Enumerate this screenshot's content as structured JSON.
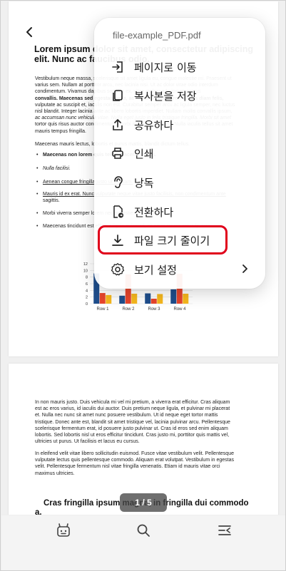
{
  "document": {
    "title_lines": [
      "Lorem ipsum dolor sit amet, consectetur adipiscing",
      "elit. Nunc ac faucibus odio."
    ],
    "paragraph1": [
      "Vestibulum neque massa, scelerisque sit amet ligula eu, congue molestie mi. Praesent ut",
      "varius sem. Nullam at porttitor arcu, nec lacinia nisi. Ut ac dolor vitae odio interdum",
      "condimentum. Vivamus dapibus sodales ex, vitae malesuada ipsum cursus",
      "convallis. Maecenas sed egestas nulla, ac condimentum orci. Mauris diam felis,",
      "vulputate ac suscipit et, iaculis non est. Curabitur semper arcu ac ligula semper, nec luctus",
      "nisl blandit. Integer lacinia ante ac libero lobortis imperdiet. Nullam mollis convallis ipsum,",
      "ac accumsan nunc vehicula vitae. Nulla eget justo in felis tristique fringilla. Morbi sit amet",
      "tortor quis risus auctor condimentum. Morbi in ullamcorper elit. Nulla iaculis tellus sit amet",
      "mauris tempus fringilla."
    ],
    "paragraph2": "Maecenas mauris lectus, lobortis et purus mattis, blandit dictum tellus.",
    "bullets": [
      "Maecenas non lorem quis tellus placerat varius.",
      "Nulla facilisi.",
      "Aenean congue fringilla justo ut aliquam.",
      "Mauris id ex erat. Nunc vulputate neque vitae justo facilisis, non condimentum ante",
      "sagittis.",
      "Morbi viverra semper lorem nec molestie.",
      "Maecenas tincidunt est efficitur ligula euismod, sit amet ornare est vulputate."
    ],
    "page2_paragraph1": [
      "In non mauris justo. Duis vehicula mi vel mi pretium, a viverra erat efficitur. Cras aliquam",
      "est ac eros varius, id iaculis dui auctor. Duis pretium neque ligula, et pulvinar mi placerat",
      "et. Nulla nec nunc sit amet nunc posuere vestibulum. Ut id neque eget tortor mattis",
      "tristique. Donec ante est, blandit sit amet tristique vel, lacinia pulvinar arcu. Pellentesque",
      "scelerisque fermentum erat, id posuere justo pulvinar ut. Cras id eros sed enim aliquam",
      "lobortis. Sed lobortis nisl ut eros efficitur tincidunt. Cras justo mi, porttitor quis mattis vel,",
      "ultricies ut purus. Ut facilisis et lacus eu cursus."
    ],
    "page2_paragraph2": [
      "In eleifend velit vitae libero sollicitudin euismod. Fusce vitae vestibulum velit. Pellentesque",
      "vulputate lectus quis pellentesque commodo. Aliquam erat volutpat. Vestibulum in egestas",
      "velit. Pellentesque fermentum nisl vitae fringilla venenatis. Etiam id mauris vitae orci",
      "maximus ultricies."
    ],
    "page2_heading_lines": [
      "Cras fringilla ipsum magna, in fringilla dui commodo",
      "a."
    ]
  },
  "chart_data": {
    "type": "bar",
    "categories": [
      "Row 1",
      "Row 2",
      "Row 3",
      "Row 4"
    ],
    "series": [
      {
        "values": [
          9.1,
          2.4,
          3.1,
          4.3
        ],
        "color": "#1f4e8c"
      },
      {
        "values": [
          3.2,
          8.8,
          1.5,
          9.0
        ],
        "color": "#e8452c"
      },
      {
        "values": [
          2.6,
          3.0,
          2.9,
          3.0
        ],
        "color": "#f6b81e"
      }
    ],
    "yticks": [
      0,
      2,
      4,
      6,
      8,
      10,
      12
    ],
    "ylim": [
      0,
      12
    ]
  },
  "menu": {
    "title": "file-example_PDF.pdf",
    "items": [
      {
        "label": "페이지로 이동",
        "icon": "go-to-page-icon"
      },
      {
        "label": "복사본을 저장",
        "icon": "copy-icon"
      },
      {
        "label": "공유하다",
        "icon": "share-icon"
      },
      {
        "label": "인쇄",
        "icon": "print-icon"
      },
      {
        "label": "낭독",
        "icon": "read-aloud-icon"
      },
      {
        "label": "전환하다",
        "icon": "convert-icon"
      },
      {
        "label": "파일 크기 줄이기",
        "icon": "download-icon"
      },
      {
        "label": "보기 설정",
        "icon": "settings-icon"
      }
    ],
    "highlight_color": "#e0001b"
  },
  "page_indicator": "1 / 5",
  "bottom_nav": [
    {
      "icon": "ai-assistant-icon"
    },
    {
      "icon": "search-icon"
    },
    {
      "icon": "outline-icon"
    }
  ]
}
